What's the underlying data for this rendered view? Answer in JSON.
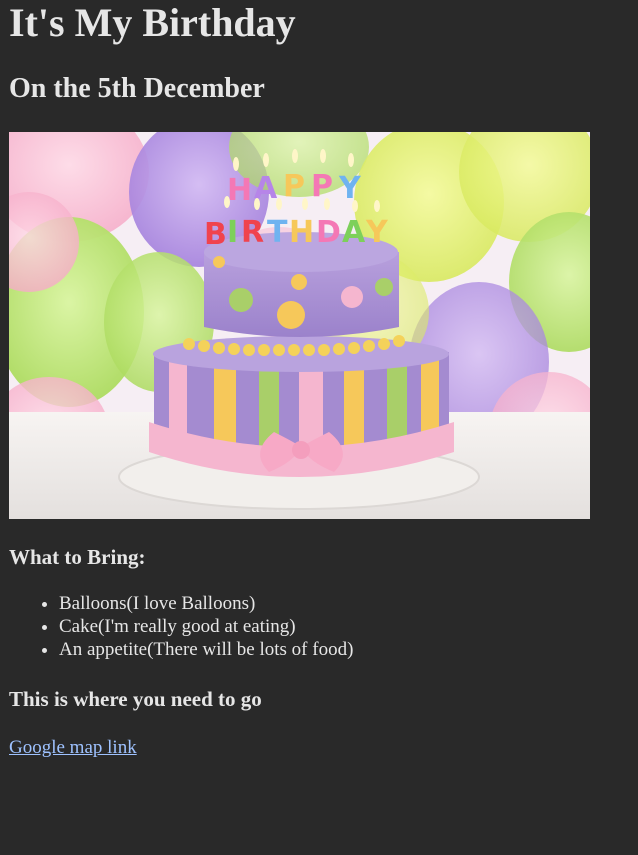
{
  "header": {
    "title": "It's My Birthday",
    "subtitle": "On the 5th December"
  },
  "image": {
    "name": "birthday-cake-photo",
    "colors": {
      "background": "#f2f0ee",
      "cake_purple": "#a48bd0",
      "cake_pink": "#f5b6cf",
      "cake_yellow": "#f6c85a",
      "cake_green": "#a9cf69",
      "balloon_yellow": "#e8f270",
      "balloon_purple": "#b692e6"
    }
  },
  "bring": {
    "heading": "What to Bring:",
    "items": [
      "Balloons(I love Balloons)",
      "Cake(I'm really good at eating)",
      "An appetite(There will be lots of food)"
    ]
  },
  "location": {
    "heading": "This is where you need to go",
    "link_text": "Google map link"
  },
  "theme": {
    "page_background": "#292929",
    "text_color": "#e6e6e6",
    "link_color": "#9ec2ff"
  }
}
